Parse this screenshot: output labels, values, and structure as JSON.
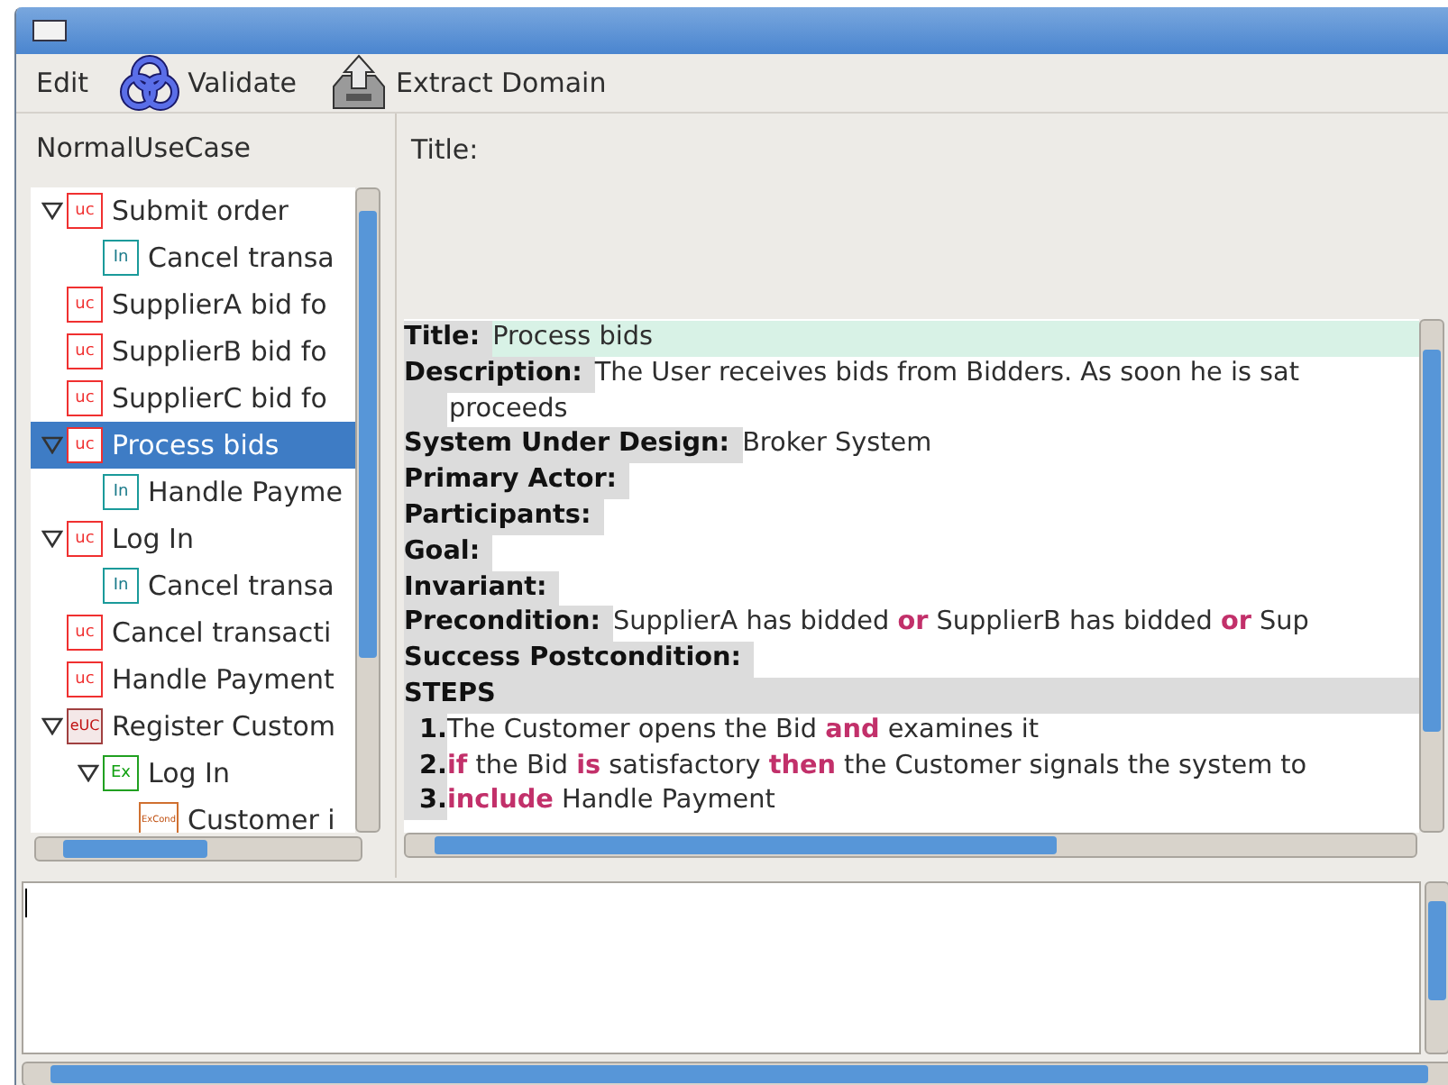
{
  "toolbar": [
    {
      "kind": "text",
      "label": "Edit"
    },
    {
      "kind": "validate",
      "label": "Validate"
    },
    {
      "kind": "extract",
      "label": "Extract Domain"
    }
  ],
  "tree_panel": {
    "label": "NormalUseCase",
    "items": [
      {
        "kind": "uc",
        "badge": "uc",
        "label": "Submit order",
        "selected": false,
        "expanded": true,
        "children": [
          {
            "kind": "in",
            "badge": "In",
            "label": "Cancel transa",
            "selected": false
          }
        ]
      },
      {
        "kind": "uc",
        "badge": "uc",
        "label": "SupplierA bid fo",
        "selected": false
      },
      {
        "kind": "uc",
        "badge": "uc",
        "label": "SupplierB bid fo",
        "selected": false
      },
      {
        "kind": "uc",
        "badge": "uc",
        "label": "SupplierC bid fo",
        "selected": false
      },
      {
        "kind": "uc",
        "badge": "uc",
        "label": "Process bids",
        "selected": true,
        "expanded": true,
        "children": [
          {
            "kind": "in",
            "badge": "In",
            "label": "Handle Payme",
            "selected": false
          }
        ]
      },
      {
        "kind": "uc",
        "badge": "uc",
        "label": "Log In",
        "selected": false,
        "expanded": true,
        "children": [
          {
            "kind": "in",
            "badge": "In",
            "label": "Cancel transa",
            "selected": false
          }
        ]
      },
      {
        "kind": "uc",
        "badge": "uc",
        "label": "Cancel transacti",
        "selected": false
      },
      {
        "kind": "uc",
        "badge": "uc",
        "label": "Handle Payment",
        "selected": false
      },
      {
        "kind": "euc",
        "badge": "eUC",
        "label": "Register Custom",
        "selected": false,
        "expanded": true,
        "children": [
          {
            "kind": "ex",
            "badge": "Ex",
            "label": "Log In",
            "selected": false,
            "expanded": true,
            "children": [
              {
                "kind": "excond",
                "badge": "ExCond",
                "label": "Customer i",
                "selected": false
              }
            ]
          }
        ]
      }
    ]
  },
  "editor": {
    "title_label": "Title:",
    "fields": [
      {
        "label": "Title:",
        "value": "Process bids",
        "highlight": true
      },
      {
        "label": "Description:",
        "value": "The User receives bids from Bidders. As soon he is sat",
        "continuation": "proceeds",
        "highlight": false
      },
      {
        "label": "System Under Design:",
        "value": "Broker System",
        "highlight": false
      },
      {
        "label": "Primary Actor:",
        "highlight": false
      },
      {
        "label": "Participants:",
        "highlight": false
      },
      {
        "label": "Goal:",
        "highlight": false
      },
      {
        "label": "Invariant:",
        "highlight": false
      },
      {
        "label": "Precondition:",
        "value": "SupplierA has bidded **or** SupplierB has bidded **or** Sup",
        "highlight": false
      },
      {
        "label": "Success Postcondition:",
        "highlight": false
      }
    ],
    "steps_heading": "STEPS",
    "steps": [
      {
        "number": "1.",
        "text": "The Customer opens the Bid **and** examines it"
      },
      {
        "number": "2.",
        "text": "**if** the Bid **is** satisfactory **then** the Customer signals the system to"
      },
      {
        "number": "3.",
        "text": "**include** Handle Payment"
      }
    ]
  }
}
